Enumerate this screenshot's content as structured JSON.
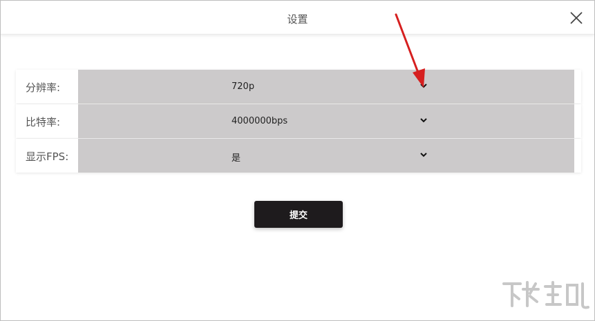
{
  "dialog": {
    "title": "设置",
    "close_icon": "close-icon"
  },
  "form": {
    "rows": [
      {
        "label": "分辨率:",
        "value": "720p",
        "icon": "chevron-down-icon"
      },
      {
        "label": "比特率:",
        "value": "4000000bps",
        "icon": "chevron-down-icon"
      },
      {
        "label": "显示FPS:",
        "value": "是",
        "icon": "chevron-down-icon"
      }
    ]
  },
  "submit": {
    "label": "提交"
  },
  "annotation": {
    "icon": "red-arrow-icon",
    "color": "#d61f1f"
  },
  "colors": {
    "select_bg": "#cccacb",
    "button_bg": "#1e1b1d"
  }
}
